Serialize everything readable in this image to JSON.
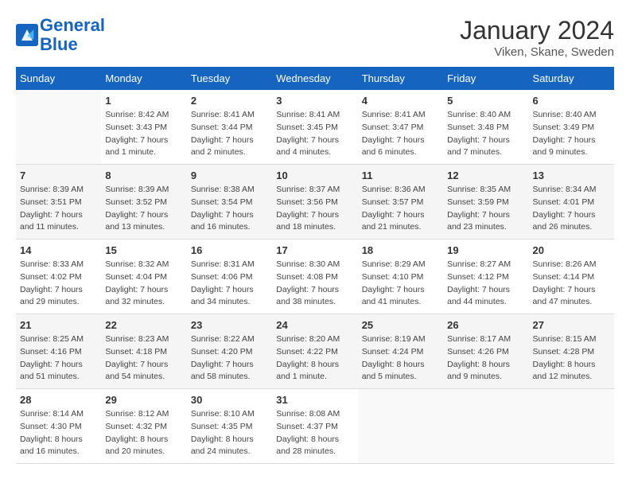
{
  "header": {
    "logo_line1": "General",
    "logo_line2": "Blue",
    "month_title": "January 2024",
    "location": "Viken, Skane, Sweden"
  },
  "weekdays": [
    "Sunday",
    "Monday",
    "Tuesday",
    "Wednesday",
    "Thursday",
    "Friday",
    "Saturday"
  ],
  "weeks": [
    [
      {
        "day": "",
        "info": ""
      },
      {
        "day": "1",
        "info": "Sunrise: 8:42 AM\nSunset: 3:43 PM\nDaylight: 7 hours\nand 1 minute."
      },
      {
        "day": "2",
        "info": "Sunrise: 8:41 AM\nSunset: 3:44 PM\nDaylight: 7 hours\nand 2 minutes."
      },
      {
        "day": "3",
        "info": "Sunrise: 8:41 AM\nSunset: 3:45 PM\nDaylight: 7 hours\nand 4 minutes."
      },
      {
        "day": "4",
        "info": "Sunrise: 8:41 AM\nSunset: 3:47 PM\nDaylight: 7 hours\nand 6 minutes."
      },
      {
        "day": "5",
        "info": "Sunrise: 8:40 AM\nSunset: 3:48 PM\nDaylight: 7 hours\nand 7 minutes."
      },
      {
        "day": "6",
        "info": "Sunrise: 8:40 AM\nSunset: 3:49 PM\nDaylight: 7 hours\nand 9 minutes."
      }
    ],
    [
      {
        "day": "7",
        "info": ""
      },
      {
        "day": "8",
        "info": "Sunrise: 8:39 AM\nSunset: 3:52 PM\nDaylight: 7 hours\nand 13 minutes."
      },
      {
        "day": "9",
        "info": "Sunrise: 8:38 AM\nSunset: 3:54 PM\nDaylight: 7 hours\nand 16 minutes."
      },
      {
        "day": "10",
        "info": "Sunrise: 8:37 AM\nSunset: 3:56 PM\nDaylight: 7 hours\nand 18 minutes."
      },
      {
        "day": "11",
        "info": "Sunrise: 8:36 AM\nSunset: 3:57 PM\nDaylight: 7 hours\nand 21 minutes."
      },
      {
        "day": "12",
        "info": "Sunrise: 8:35 AM\nSunset: 3:59 PM\nDaylight: 7 hours\nand 23 minutes."
      },
      {
        "day": "13",
        "info": "Sunrise: 8:34 AM\nSunset: 4:01 PM\nDaylight: 7 hours\nand 26 minutes."
      }
    ],
    [
      {
        "day": "14",
        "info": ""
      },
      {
        "day": "15",
        "info": "Sunrise: 8:32 AM\nSunset: 4:04 PM\nDaylight: 7 hours\nand 32 minutes."
      },
      {
        "day": "16",
        "info": "Sunrise: 8:31 AM\nSunset: 4:06 PM\nDaylight: 7 hours\nand 34 minutes."
      },
      {
        "day": "17",
        "info": "Sunrise: 8:30 AM\nSunset: 4:08 PM\nDaylight: 7 hours\nand 38 minutes."
      },
      {
        "day": "18",
        "info": "Sunrise: 8:29 AM\nSunset: 4:10 PM\nDaylight: 7 hours\nand 41 minutes."
      },
      {
        "day": "19",
        "info": "Sunrise: 8:27 AM\nSunset: 4:12 PM\nDaylight: 7 hours\nand 44 minutes."
      },
      {
        "day": "20",
        "info": "Sunrise: 8:26 AM\nSunset: 4:14 PM\nDaylight: 7 hours\nand 47 minutes."
      }
    ],
    [
      {
        "day": "21",
        "info": ""
      },
      {
        "day": "22",
        "info": "Sunrise: 8:23 AM\nSunset: 4:18 PM\nDaylight: 7 hours\nand 54 minutes."
      },
      {
        "day": "23",
        "info": "Sunrise: 8:22 AM\nSunset: 4:20 PM\nDaylight: 7 hours\nand 58 minutes."
      },
      {
        "day": "24",
        "info": "Sunrise: 8:20 AM\nSunset: 4:22 PM\nDaylight: 8 hours\nand 1 minute."
      },
      {
        "day": "25",
        "info": "Sunrise: 8:19 AM\nSunset: 4:24 PM\nDaylight: 8 hours\nand 5 minutes."
      },
      {
        "day": "26",
        "info": "Sunrise: 8:17 AM\nSunset: 4:26 PM\nDaylight: 8 hours\nand 9 minutes."
      },
      {
        "day": "27",
        "info": "Sunrise: 8:15 AM\nSunset: 4:28 PM\nDaylight: 8 hours\nand 12 minutes."
      }
    ],
    [
      {
        "day": "28",
        "info": "Sunrise: 8:14 AM\nSunset: 4:30 PM\nDaylight: 8 hours\nand 16 minutes."
      },
      {
        "day": "29",
        "info": "Sunrise: 8:12 AM\nSunset: 4:32 PM\nDaylight: 8 hours\nand 20 minutes."
      },
      {
        "day": "30",
        "info": "Sunrise: 8:10 AM\nSunset: 4:35 PM\nDaylight: 8 hours\nand 24 minutes."
      },
      {
        "day": "31",
        "info": "Sunrise: 8:08 AM\nSunset: 4:37 PM\nDaylight: 8 hours\nand 28 minutes."
      },
      {
        "day": "",
        "info": ""
      },
      {
        "day": "",
        "info": ""
      },
      {
        "day": "",
        "info": ""
      }
    ]
  ],
  "week1_sun_info": "Sunrise: 8:39 AM\nSunset: 3:51 PM\nDaylight: 7 hours\nand 11 minutes.",
  "week3_sun_info": "Sunrise: 8:33 AM\nSunset: 4:02 PM\nDaylight: 7 hours\nand 29 minutes.",
  "week4_sun_info": "Sunrise: 8:25 AM\nSunset: 4:16 PM\nDaylight: 7 hours\nand 51 minutes."
}
